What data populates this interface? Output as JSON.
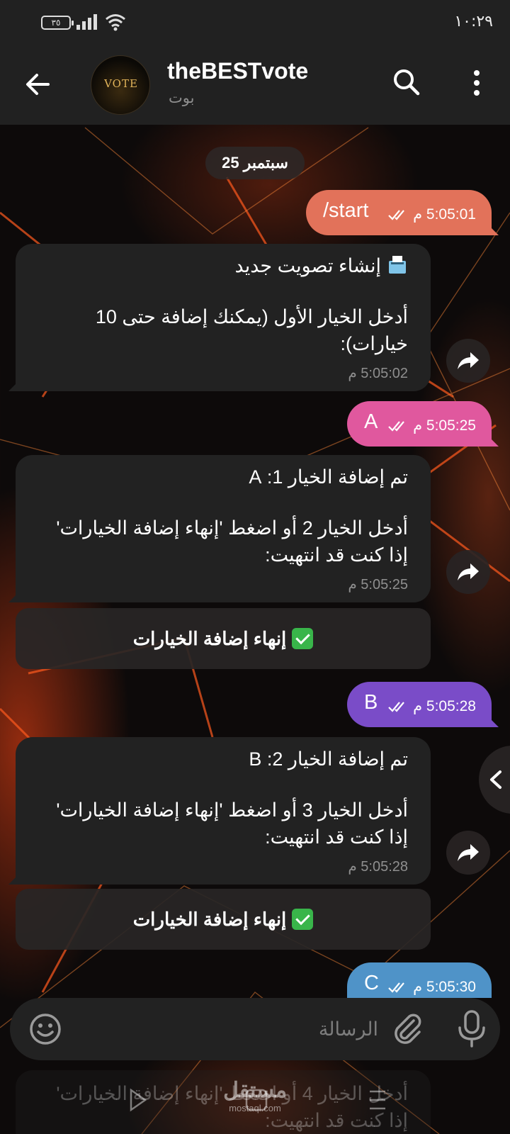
{
  "status_bar": {
    "time": "١٠:٢٩",
    "battery": "٣٥"
  },
  "header": {
    "title": "theBESTvote",
    "subtitle": "بوت",
    "avatar_text": "VOTE"
  },
  "chat": {
    "date": "25 سبتمبر",
    "messages": [
      {
        "kind": "out",
        "text": "/start",
        "time": "5:05:01 م",
        "color": "#e2725a"
      },
      {
        "kind": "in",
        "title": "إنشاء تصويت جديد",
        "lines": [
          "أدخل الخيار الأول (يمكنك إضافة حتى 10",
          "خيارات):"
        ],
        "time": "5:05:02 م"
      },
      {
        "kind": "out",
        "text": "A",
        "time": "5:05:25 م",
        "color": "#e0589e"
      },
      {
        "kind": "in",
        "title": "تم إضافة الخيار 1: A",
        "lines": [
          "أدخل الخيار 2 أو اضغط 'إنهاء إضافة الخيارات'",
          "إذا كنت قد انتهيت:"
        ],
        "time": "5:05:25 م"
      },
      {
        "kind": "button",
        "label": "إنهاء إضافة الخيارات"
      },
      {
        "kind": "out",
        "text": "B",
        "time": "5:05:28 م",
        "color": "#7a4cc8"
      },
      {
        "kind": "in",
        "title": "تم إضافة الخيار 2: B",
        "lines": [
          "أدخل الخيار 3 أو اضغط 'إنهاء إضافة الخيارات'",
          "إذا كنت قد انتهيت:"
        ],
        "time": "5:05:28 م"
      },
      {
        "kind": "button",
        "label": "إنهاء إضافة الخيارات"
      },
      {
        "kind": "out",
        "text": "C",
        "time": "5:05:30 م",
        "color": "#4f93c8"
      }
    ],
    "faded_lines": [
      "أدخل الخيار 4 أو اضغط 'إنهاء إضافة الخيارات'",
      "إذا كنت قد انتهيت:"
    ]
  },
  "composer": {
    "placeholder": "الرسالة"
  },
  "watermark": {
    "brand": "مستقل",
    "domain": "mostaql.com"
  },
  "colors": {
    "header_bg": "#212121",
    "incoming_bubble": "#222222",
    "check_green": "#39b54a"
  },
  "icons": [
    "back-arrow-icon",
    "search-icon",
    "more-vertical-icon",
    "share-icon",
    "emoji-icon",
    "attach-icon",
    "mic-icon",
    "chevron-left-icon",
    "ballot-box-icon",
    "check-mark-icon"
  ]
}
